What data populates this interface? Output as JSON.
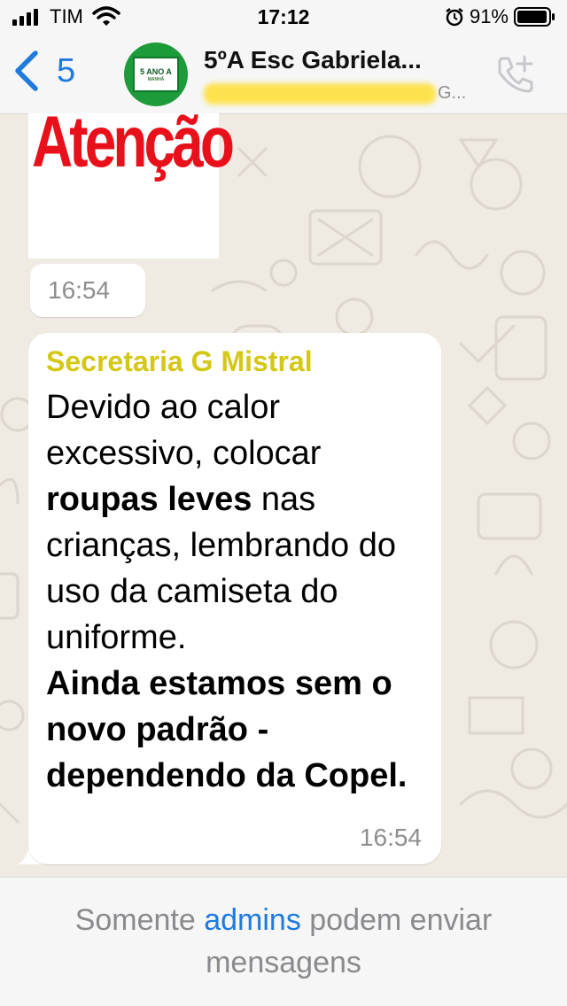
{
  "status_bar": {
    "carrier": "TIM",
    "time": "17:12",
    "battery_percent": "91%"
  },
  "header": {
    "back_count": "5",
    "avatar_text": "5 ANO A",
    "avatar_subtext": "MANHÃ",
    "title": "5ºA  Esc Gabriela...",
    "subtitle_suffix": "G..."
  },
  "messages": [
    {
      "type": "image",
      "image_text": "Atenção",
      "time": "16:54"
    },
    {
      "type": "text",
      "sender": "Secretaria G Mistral",
      "body_1": "Devido ao calor excessivo, colocar ",
      "body_bold_1": "roupas leves",
      "body_2": " nas crianças, lembrando do uso da camiseta do uniforme.",
      "body_bold_2": "Ainda estamos sem o novo padrão - dependendo da Copel.",
      "time": "16:54"
    }
  ],
  "footer": {
    "text_before": "Somente ",
    "link": "admins",
    "text_after": " podem enviar mensagens"
  },
  "colors": {
    "accent": "#1f7ae0",
    "sender": "#d4c716",
    "image_text": "#e8101a",
    "avatar": "#1d9a3a"
  }
}
